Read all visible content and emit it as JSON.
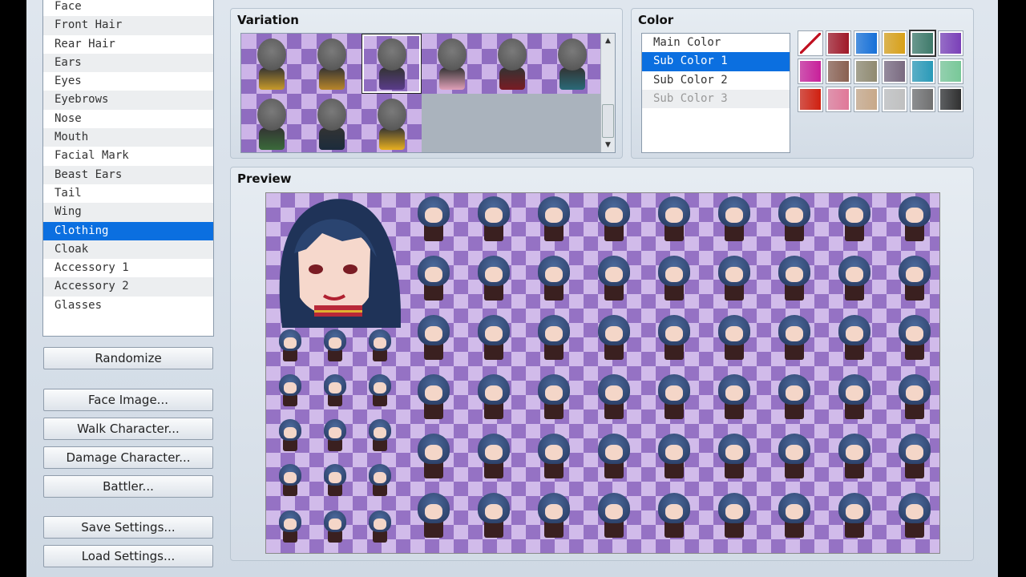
{
  "parts": {
    "items": [
      "Face",
      "Front Hair",
      "Rear Hair",
      "Ears",
      "Eyes",
      "Eyebrows",
      "Nose",
      "Mouth",
      "Facial Mark",
      "Beast Ears",
      "Tail",
      "Wing",
      "Clothing",
      "Cloak",
      "Accessory 1",
      "Accessory 2",
      "Glasses"
    ],
    "selected": "Clothing"
  },
  "buttons": {
    "randomize": "Randomize",
    "face_image": "Face Image...",
    "walk_character": "Walk Character...",
    "damage_character": "Damage Character...",
    "battler": "Battler...",
    "save_settings": "Save Settings...",
    "load_settings": "Load Settings..."
  },
  "variation": {
    "title": "Variation",
    "count": 9,
    "selected_index": 2,
    "body_colors": [
      "#c79a2a",
      "#b8862a",
      "#5a3c8a",
      "#e0a0b8",
      "#7a1c24",
      "#2a6a78",
      "#3a6a3a",
      "#1c2c3c",
      "#e8b020"
    ]
  },
  "color": {
    "title": "Color",
    "items": [
      "Main Color",
      "Sub Color 1",
      "Sub Color 2",
      "Sub Color 3"
    ],
    "selected": "Sub Color 1",
    "disabled": [
      "Sub Color 3"
    ],
    "swatches": [
      "none",
      "#a01828",
      "#1670d8",
      "#d8a018",
      "#3e7a6a",
      "#7a40b8",
      "#c8209a",
      "#8a6050",
      "#908a70",
      "#7a6a80",
      "#2a9ab8",
      "#78c898",
      "#d02010",
      "#e07898",
      "#c8a888",
      "#c0c0c0",
      "#707070",
      "#303030"
    ],
    "selected_swatch": 4
  },
  "preview": {
    "title": "Preview"
  }
}
